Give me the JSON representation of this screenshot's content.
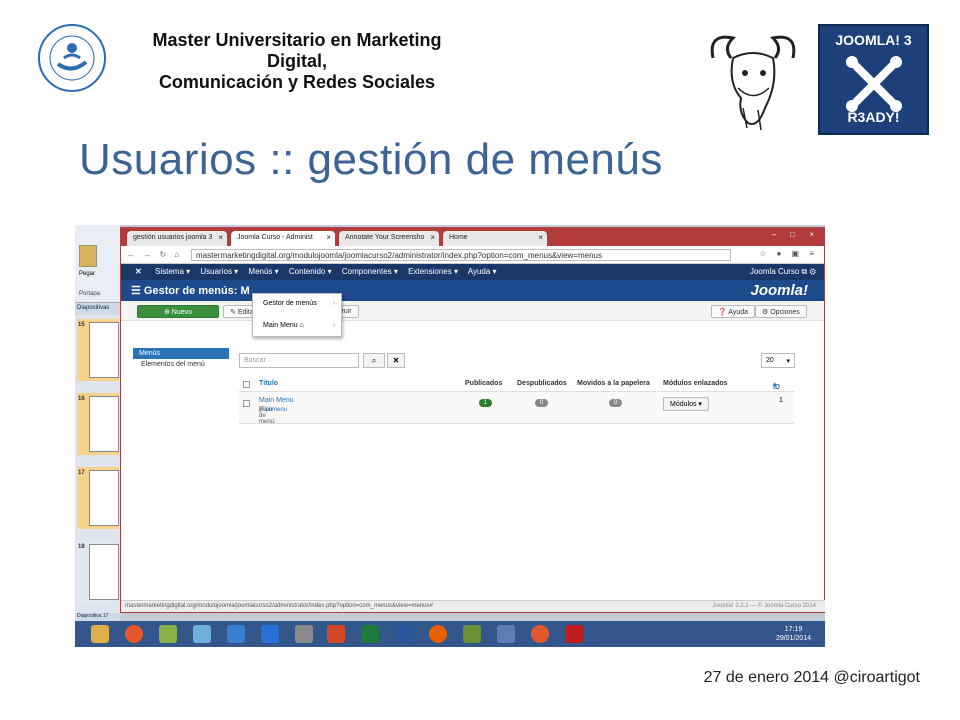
{
  "header": {
    "master_line1": "Master Universitario en Marketing Digital,",
    "master_line2": "Comunicación y Redes Sociales",
    "seal_text": "UNIVERSIDAD CAMILO JOSÉ CELA",
    "badge_top": "JOOMLA! 3",
    "badge_bottom": "R3ADY!"
  },
  "slide_title": "Usuarios :: gestión de menús",
  "footer": "27 de enero 2014 @ciroartigot",
  "screenshot": {
    "powerpoint": {
      "pegar": "Pegar",
      "portapapeles": "Portapa",
      "tab": "Diapositivas",
      "bottom": "Diapositiva 17",
      "thumbs": [
        "15",
        "16",
        "17",
        "18"
      ]
    },
    "browser": {
      "tabs": [
        {
          "label": "gestión usuarios joomla 3"
        },
        {
          "label": "Joomla Curso - Administ"
        },
        {
          "label": "Annotate Your Screensho"
        },
        {
          "label": "Home"
        }
      ],
      "url": "mastermarketingdigital.org/modulojoomla/joomlacurso2/administrator/index.php?option=com_menus&view=menus",
      "status_url": "mastermarketingdigital.org/modulojoomla/joomlacurso2/administrator/index.php?option=com_menus&view=menus#",
      "status_right": "Joomla! 3.2.1 — © Joomla Curso 2014"
    },
    "joomla": {
      "nav": [
        "Sistema ▾",
        "Usuarios ▾",
        "Menús ▾",
        "Contenido ▾",
        "Componentes ▾",
        "Extensiones ▾",
        "Ayuda ▾"
      ],
      "nav_right": "Joomla Curso ⧉",
      "page_title": "Gestor de menús: M",
      "brand": "Joomla!",
      "dropdown": [
        "Gestor de menús",
        "Main Menu"
      ],
      "toolbar": {
        "new": "Nuevo",
        "edit": "Edita",
        "rebuild": "struir",
        "help": "Ayuda",
        "options": "Opciones"
      },
      "sidebar": {
        "active": "Menús",
        "item": "Elementos del menú"
      },
      "search_placeholder": "Buscar",
      "limit": "20",
      "columns": {
        "title": "Título",
        "published": "Publicados",
        "unpublished": "Despublicados",
        "trashed": "Movidos a la papelera",
        "modules": "Módulos enlazados",
        "id": "ID"
      },
      "row": {
        "title": "Main Menu",
        "subtitle_prefix": "(Tipo de menú: ",
        "subtitle_link": "mainmenu",
        "subtitle_suffix": ")",
        "published": "1",
        "unpublished": "0",
        "trashed": "0",
        "modules_btn": "Módulos ▾",
        "id": "1"
      }
    },
    "taskbar": {
      "time": "17:19",
      "date": "29/01/2014"
    }
  },
  "colors": {
    "title": "#3c6395",
    "joomla_nav": "#1a3867",
    "joomla_head": "#1d4a8c",
    "badge": "#1d3f7a"
  }
}
